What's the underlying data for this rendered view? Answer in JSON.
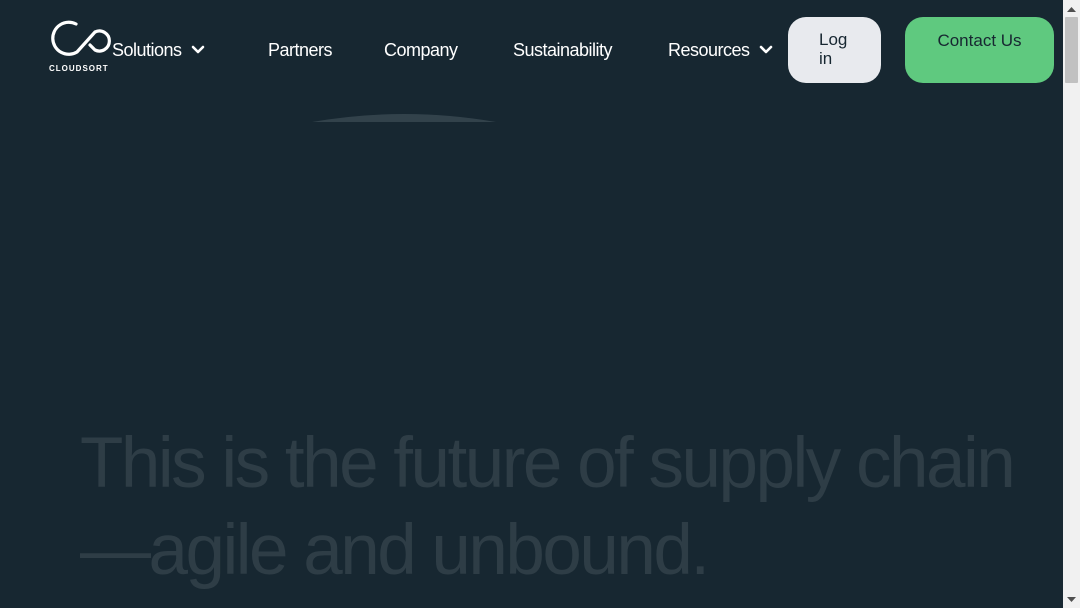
{
  "logo": {
    "text": "CLOUDSORT",
    "icon": "infinity-cloud-logo"
  },
  "nav": {
    "solutions": "Solutions",
    "partners": "Partners",
    "company": "Company",
    "sustainability": "Sustainability",
    "resources": "Resources"
  },
  "actions": {
    "login": "Log in",
    "contact": "Contact Us"
  },
  "hero": {
    "headline": "This is the future of supply chain—agile and unbound."
  },
  "colors": {
    "background": "#172731",
    "login_button": "#e8eaee",
    "contact_button": "#5fc97f",
    "hero_text": "#2e3d46"
  }
}
